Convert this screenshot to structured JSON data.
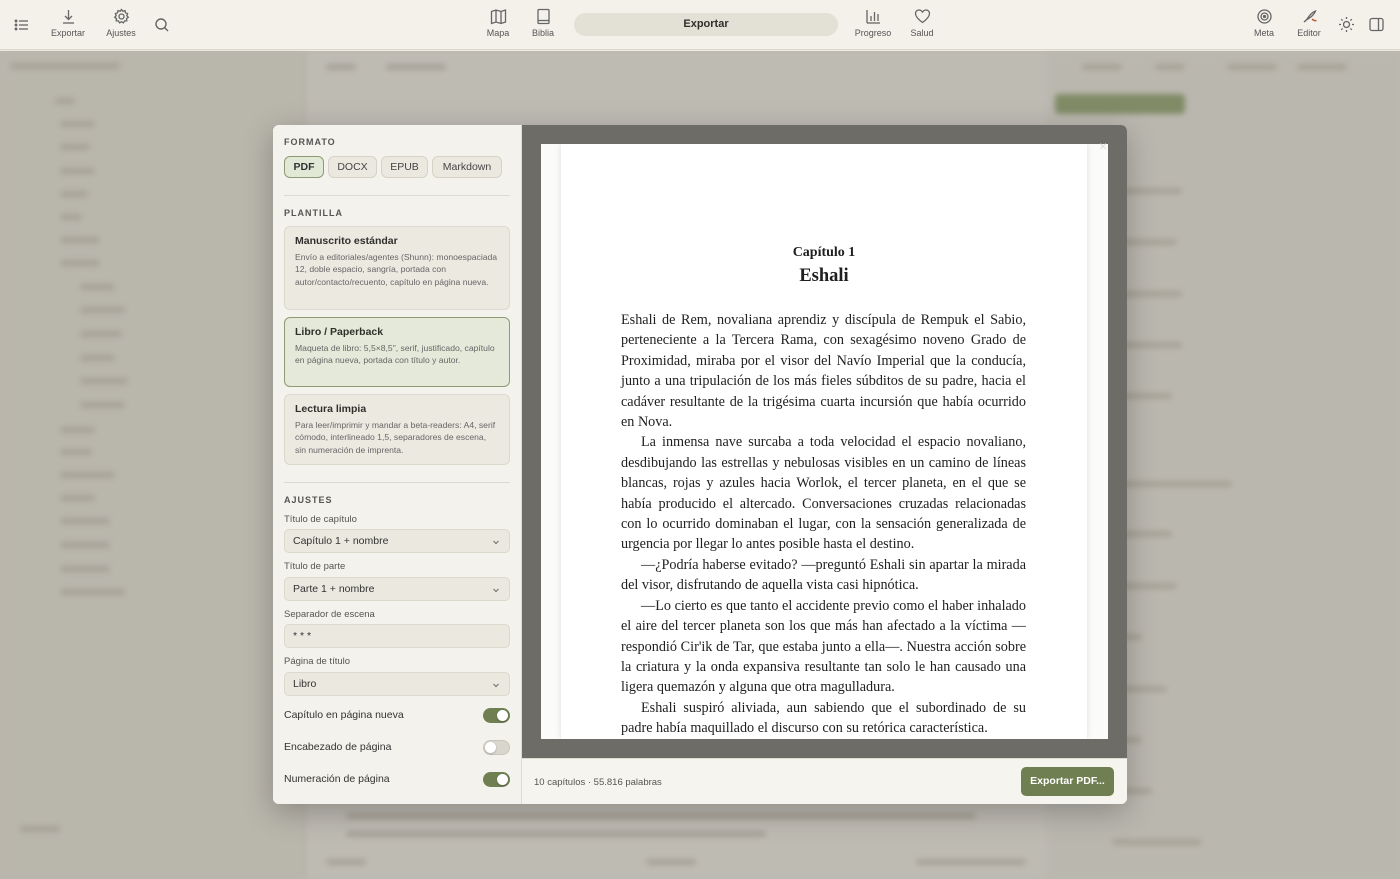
{
  "toolbar": {
    "export": "Exportar",
    "settings": "Ajustes",
    "map": "Mapa",
    "bible": "Biblia",
    "center_title": "Exportar",
    "progress": "Progreso",
    "health": "Salud",
    "goal": "Meta",
    "editor": "Editor"
  },
  "dialog": {
    "format_section": "FORMATO",
    "formats": [
      "PDF",
      "DOCX",
      "EPUB",
      "Markdown"
    ],
    "selected_format": "PDF",
    "template_section": "PLANTILLA",
    "templates": [
      {
        "title": "Manuscrito estándar",
        "desc": "Envío a editoriales/agentes (Shunn): monoespaciada 12, doble espacio, sangría, portada con autor/contacto/recuento, capítulo en página nueva."
      },
      {
        "title": "Libro / Paperback",
        "desc": "Maqueta de libro: 5,5×8,5\", serif, justificado, capítulo en página nueva, portada con título y autor."
      },
      {
        "title": "Lectura limpia",
        "desc": "Para leer/imprimir y mandar a beta-readers: A4, serif cómodo, interlineado 1,5, separadores de escena, sin numeración de imprenta."
      }
    ],
    "selected_template": "Libro / Paperback",
    "settings_section": "AJUSTES",
    "chapter_title_label": "Título de capítulo",
    "chapter_title_value": "Capítulo 1 + nombre",
    "part_title_label": "Título de parte",
    "part_title_value": "Parte 1 + nombre",
    "scene_sep_label": "Separador de escena",
    "scene_sep_value": "* * *",
    "title_page_label": "Página de título",
    "title_page_value": "Libro",
    "toggles": [
      {
        "label": "Capítulo en página nueva",
        "on": true
      },
      {
        "label": "Encabezado de página",
        "on": false
      },
      {
        "label": "Numeración de página",
        "on": true
      }
    ],
    "stats": "10 capítulos · 55.816 palabras",
    "export_button": "Exportar PDF..."
  },
  "preview": {
    "chapter_label": "Capítulo 1",
    "chapter_title": "Eshali",
    "paragraphs": [
      "Eshali de Rem, novaliana aprendiz y discípula de Rempuk el Sabio, perteneciente a la Tercera Rama, con sexagésimo noveno Grado de Proximidad, miraba por el visor del Navío Imperial que la conducía, junto a una tripulación de los más fieles súbditos de su padre, hacia el cadáver resultante de la trigésima cuarta incursión que había ocurrido en Nova.",
      "La inmensa nave surcaba a toda velocidad el espacio novaliano, desdibujando las estrellas y nebulosas visibles en un camino de líneas blancas, rojas y azules hacia Worlok, el tercer planeta, en el que se había producido el altercado. Conversaciones cruzadas relacionadas con lo ocurrido dominaban el lugar, con la sensación generalizada de urgencia por llegar lo antes posible hasta el destino.",
      "—¿Podría haberse evitado? —preguntó Eshali sin apartar la mirada del visor, disfrutando de aquella vista casi hipnótica.",
      "—Lo cierto es que tanto el accidente previo como el haber inhalado el aire del tercer planeta son los que más han afectado a la víctima —respondió Cir'ik de Tar, que estaba junto a ella—. Nuestra acción sobre la criatura y la onda expansiva resultante tan solo le han causado una ligera quemazón y alguna que otra magulladura.",
      "Eshali suspiró aliviada, aun sabiendo que el subordinado de su padre había maquillado el discurso con su retórica característica."
    ]
  },
  "colors": {
    "accent": "#6f7f52",
    "selected_bg": "#e5e9da"
  }
}
